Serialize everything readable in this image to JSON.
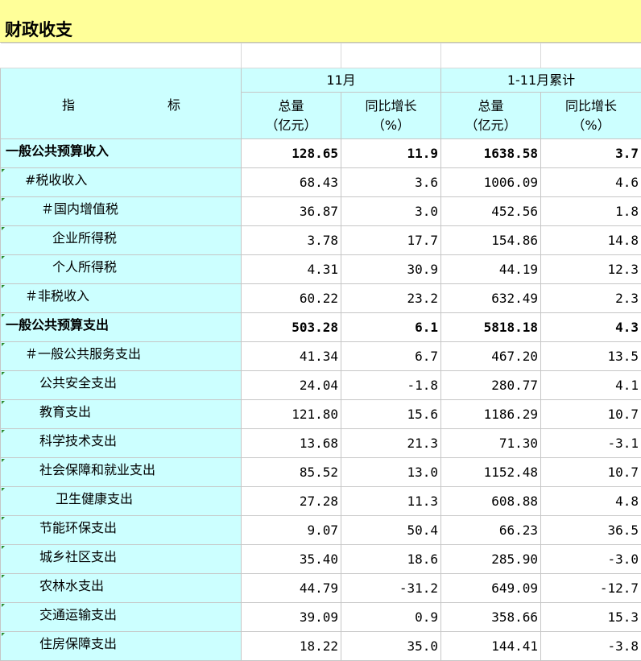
{
  "title": "财政收支",
  "header": {
    "indicator_a": "指",
    "indicator_b": "标",
    "period_month": "11月",
    "period_cumulative": "1-11月累计",
    "total_line1": "总量",
    "total_line2": "（亿元）",
    "growth_line1": "同比增长",
    "growth_line2": "（%）"
  },
  "rows": [
    {
      "label": "一般公共预算收入",
      "m_total": "128.65",
      "m_growth": "11.9",
      "c_total": "1638.58",
      "c_growth": "3.7"
    },
    {
      "label": "#税收收入",
      "m_total": "68.43",
      "m_growth": "3.6",
      "c_total": "1006.09",
      "c_growth": "4.6"
    },
    {
      "label": "＃国内增值税",
      "m_total": "36.87",
      "m_growth": "3.0",
      "c_total": "452.56",
      "c_growth": "1.8"
    },
    {
      "label": "企业所得税",
      "m_total": "3.78",
      "m_growth": "17.7",
      "c_total": "154.86",
      "c_growth": "14.8"
    },
    {
      "label": "个人所得税",
      "m_total": "4.31",
      "m_growth": "30.9",
      "c_total": "44.19",
      "c_growth": "12.3"
    },
    {
      "label": "＃非税收入",
      "m_total": "60.22",
      "m_growth": "23.2",
      "c_total": "632.49",
      "c_growth": "2.3"
    },
    {
      "label": "一般公共预算支出",
      "m_total": "503.28",
      "m_growth": "6.1",
      "c_total": "5818.18",
      "c_growth": "4.3"
    },
    {
      "label": "＃一般公共服务支出",
      "m_total": "41.34",
      "m_growth": "6.7",
      "c_total": "467.20",
      "c_growth": "13.5"
    },
    {
      "label": "公共安全支出",
      "m_total": "24.04",
      "m_growth": "-1.8",
      "c_total": "280.77",
      "c_growth": "4.1"
    },
    {
      "label": "教育支出",
      "m_total": "121.80",
      "m_growth": "15.6",
      "c_total": "1186.29",
      "c_growth": "10.7"
    },
    {
      "label": "科学技术支出",
      "m_total": "13.68",
      "m_growth": "21.3",
      "c_total": "71.30",
      "c_growth": "-3.1"
    },
    {
      "label": "社会保障和就业支出",
      "m_total": "85.52",
      "m_growth": "13.0",
      "c_total": "1152.48",
      "c_growth": "10.7"
    },
    {
      "label": "卫生健康支出",
      "m_total": "27.28",
      "m_growth": "11.3",
      "c_total": "608.88",
      "c_growth": "4.8"
    },
    {
      "label": "节能环保支出",
      "m_total": "9.07",
      "m_growth": "50.4",
      "c_total": "66.23",
      "c_growth": "36.5"
    },
    {
      "label": "城乡社区支出",
      "m_total": "35.40",
      "m_growth": "18.6",
      "c_total": "285.90",
      "c_growth": "-3.0"
    },
    {
      "label": "农林水支出",
      "m_total": "44.79",
      "m_growth": "-31.2",
      "c_total": "649.09",
      "c_growth": "-12.7"
    },
    {
      "label": "交通运输支出",
      "m_total": "39.09",
      "m_growth": "0.9",
      "c_total": "358.66",
      "c_growth": "15.3"
    },
    {
      "label": "住房保障支出",
      "m_total": "18.22",
      "m_growth": "35.0",
      "c_total": "144.41",
      "c_growth": "-3.8"
    }
  ],
  "colors": {
    "title_bg": "#ffff99",
    "label_bg": "#ccffff",
    "cell_marker": "#2e8b2e"
  }
}
